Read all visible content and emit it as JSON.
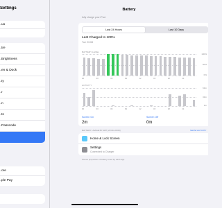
{
  "sidebar": {
    "title": "Settings",
    "groups": [
      {
        "items": [
          {
            "label": "...uo"
          },
          {
            "label": ""
          }
        ]
      },
      {
        "items": [
          {
            "label": "...tre"
          },
          {
            "label": "...Brightness"
          },
          {
            "label": "...en & Dock"
          },
          {
            "label": "...ty"
          },
          {
            "label": "...r"
          },
          {
            "label": "...n"
          },
          {
            "label": "...ts"
          },
          {
            "label": "...Passcode"
          },
          {
            "label": ""
          },
          {
            "label": "..."
          }
        ]
      },
      {
        "items": [
          {
            "label": "...ore"
          },
          {
            "label": "...ple Pay"
          }
        ]
      },
      {
        "items": [
          {
            "label": ""
          }
        ]
      }
    ]
  },
  "main": {
    "title": "Battery",
    "intro": "fully charge your iPad.",
    "tabs": [
      {
        "label": "Last 24 Hours",
        "active": true
      },
      {
        "label": "Last 10 Days",
        "active": false
      }
    ],
    "last_charged": "Last Charged to 100%",
    "last_charged_time": "Tue 23:08",
    "battery_level_label": "BATTERY LEVEL",
    "activity_label": "ACTIVITY",
    "battery_pct_labels": [
      "100%",
      "50%",
      "0%"
    ],
    "activity_labels": [
      "60m",
      "30m",
      "0m"
    ],
    "time_ticks": [
      "00",
      "03",
      "06",
      "09",
      "12",
      "15",
      "18",
      "21"
    ],
    "screen_on_label": "Screen On",
    "screen_on_value": "2m",
    "screen_off_label": "Screen Off",
    "screen_off_value": "0m",
    "usage_header": "BATTERY USAGE BY APP (23:00–00:00)",
    "show_activity": "SHOW ACTIVITY",
    "apps": [
      {
        "name": "Home & Lock Screen",
        "detail": ""
      },
      {
        "name": "Settings",
        "detail": "Connected to Charger"
      }
    ],
    "note": "Shows proportion of battery used by each app."
  },
  "colors": {
    "accent": "#3478f6",
    "battery_fill": "#c7c7cc",
    "charging": "#34c759",
    "activity": "#c7c7cc"
  },
  "chart_data": [
    {
      "type": "bar",
      "title": "BATTERY LEVEL",
      "categories": [
        "00",
        "",
        "",
        "03",
        "",
        "",
        "06",
        "",
        "",
        "09",
        "",
        "",
        "12",
        "",
        "",
        "15",
        "",
        "",
        "18",
        "",
        "",
        "21",
        "",
        ""
      ],
      "values": [
        85,
        82,
        80,
        78,
        76,
        100,
        100,
        100,
        98,
        96,
        95,
        94,
        93,
        92,
        91,
        90,
        89,
        88,
        87,
        86,
        85,
        84,
        83,
        82
      ],
      "charging_indices": [
        5,
        6,
        7
      ],
      "ylim": [
        0,
        100
      ],
      "ylabel": ""
    },
    {
      "type": "bar",
      "title": "ACTIVITY",
      "categories": [
        "00",
        "",
        "",
        "03",
        "",
        "",
        "06",
        "",
        "",
        "09",
        "",
        "",
        "12",
        "",
        "",
        "15",
        "",
        "",
        "18",
        "",
        "",
        "21",
        "",
        ""
      ],
      "values": [
        45,
        30,
        52,
        0,
        0,
        0,
        2,
        0,
        0,
        0,
        2,
        0,
        0,
        0,
        2,
        0,
        0,
        0,
        40,
        0,
        35,
        40,
        0,
        20
      ],
      "ylim": [
        0,
        60
      ],
      "ylabel": ""
    }
  ]
}
